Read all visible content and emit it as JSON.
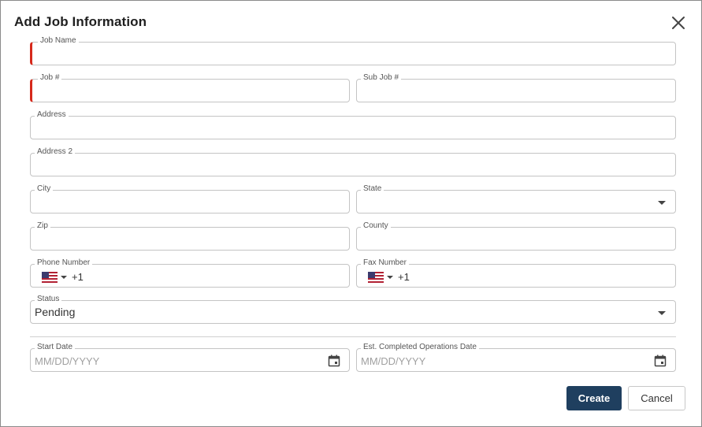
{
  "dialog": {
    "title": "Add Job Information",
    "close_icon": "close-icon"
  },
  "fields": {
    "job_name": {
      "label": "Job Name",
      "required": true,
      "value": ""
    },
    "job_number": {
      "label": "Job #",
      "required": true,
      "value": ""
    },
    "sub_job_number": {
      "label": "Sub Job #",
      "value": ""
    },
    "address": {
      "label": "Address",
      "value": ""
    },
    "address2": {
      "label": "Address 2",
      "value": ""
    },
    "city": {
      "label": "City",
      "value": ""
    },
    "state": {
      "label": "State",
      "value": ""
    },
    "zip": {
      "label": "Zip",
      "value": ""
    },
    "county": {
      "label": "County",
      "value": ""
    },
    "phone": {
      "label": "Phone Number",
      "country": "US",
      "dial_code": "+1"
    },
    "fax": {
      "label": "Fax Number",
      "country": "US",
      "dial_code": "+1"
    },
    "status": {
      "label": "Status",
      "value": "Pending"
    },
    "start_date": {
      "label": "Start Date",
      "placeholder": "MM/DD/YYYY"
    },
    "est_completed_date": {
      "label": "Est. Completed Operations Date",
      "placeholder": "MM/DD/YYYY"
    }
  },
  "buttons": {
    "create": "Create",
    "cancel": "Cancel"
  },
  "colors": {
    "required_marker": "#d6291b",
    "primary_button": "#1f3f5f",
    "border": "#c4c4c4"
  }
}
